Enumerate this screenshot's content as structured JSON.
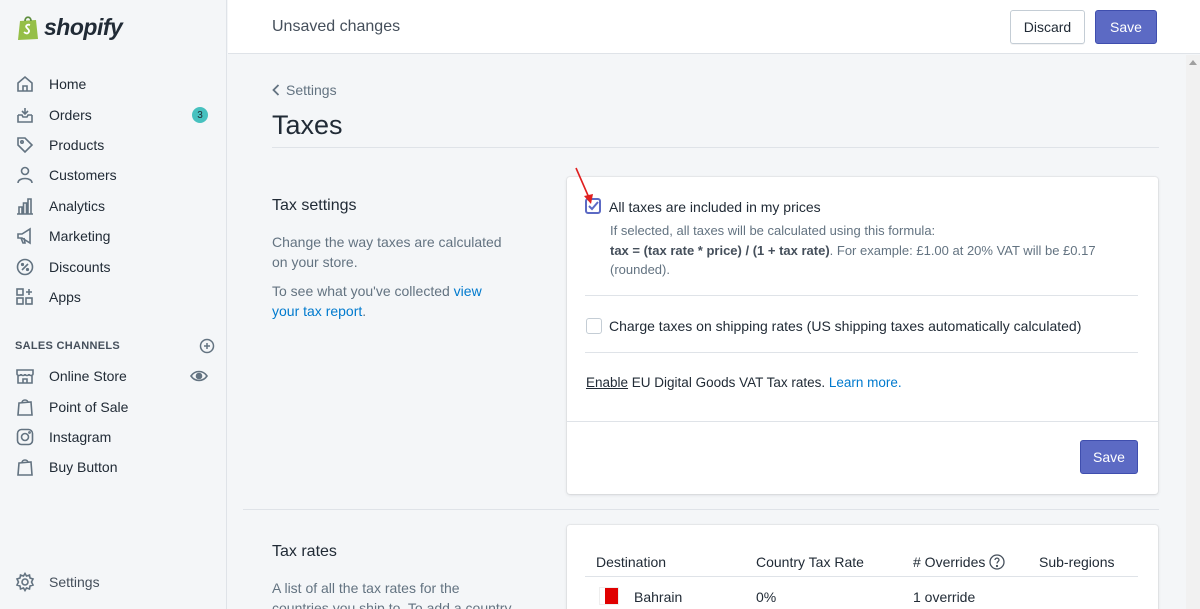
{
  "brand": {
    "name": "shopify",
    "accent": "#5c6ac4"
  },
  "sidebar": {
    "items": [
      {
        "label": "Home",
        "icon": "home-icon"
      },
      {
        "label": "Orders",
        "icon": "orders-icon",
        "badge": "3"
      },
      {
        "label": "Products",
        "icon": "tag-icon"
      },
      {
        "label": "Customers",
        "icon": "person-icon"
      },
      {
        "label": "Analytics",
        "icon": "bar-chart-icon"
      },
      {
        "label": "Marketing",
        "icon": "megaphone-icon"
      },
      {
        "label": "Discounts",
        "icon": "discount-icon"
      },
      {
        "label": "Apps",
        "icon": "apps-icon"
      }
    ],
    "sales_channels_heading": "SALES CHANNELS",
    "channels": [
      {
        "label": "Online Store",
        "icon": "store-icon"
      },
      {
        "label": "Point of Sale",
        "icon": "shopping-bag-icon"
      },
      {
        "label": "Instagram",
        "icon": "instagram-icon"
      },
      {
        "label": "Buy Button",
        "icon": "shopping-bag-icon"
      }
    ],
    "settings_label": "Settings"
  },
  "topbar": {
    "status": "Unsaved changes",
    "discard_label": "Discard",
    "save_label": "Save"
  },
  "page": {
    "breadcrumb": "Settings",
    "title": "Taxes"
  },
  "tax_settings": {
    "title": "Tax settings",
    "desc1": "Change the way taxes are calculated on your store.",
    "desc2_prefix": "To see what you've collected ",
    "desc2_link": "view your tax report",
    "desc2_suffix": ".",
    "option1": {
      "label": "All taxes are included in my prices",
      "checked": true,
      "help_intro": "If selected, all taxes will be calculated using this formula:",
      "help_formula": "tax = (tax rate * price) / (1 + tax rate)",
      "help_example": ". For example: £1.00 at 20% VAT will be £0.17 (rounded)."
    },
    "option2": {
      "label": "Charge taxes on shipping rates (US shipping taxes automatically calculated)",
      "checked": false
    },
    "eu": {
      "enable": "Enable",
      "text": " EU Digital Goods VAT Tax rates. ",
      "learn_more": "Learn more."
    },
    "save_label": "Save"
  },
  "tax_rates": {
    "title": "Tax rates",
    "desc": "A list of all the tax rates for the countries you ship to. To add a country",
    "columns": [
      "Destination",
      "Country Tax Rate",
      "# Overrides",
      "Sub-regions"
    ],
    "rows": [
      {
        "destination": "Bahrain",
        "rate": "0%",
        "overrides": "1 override",
        "subregions": ""
      }
    ]
  }
}
